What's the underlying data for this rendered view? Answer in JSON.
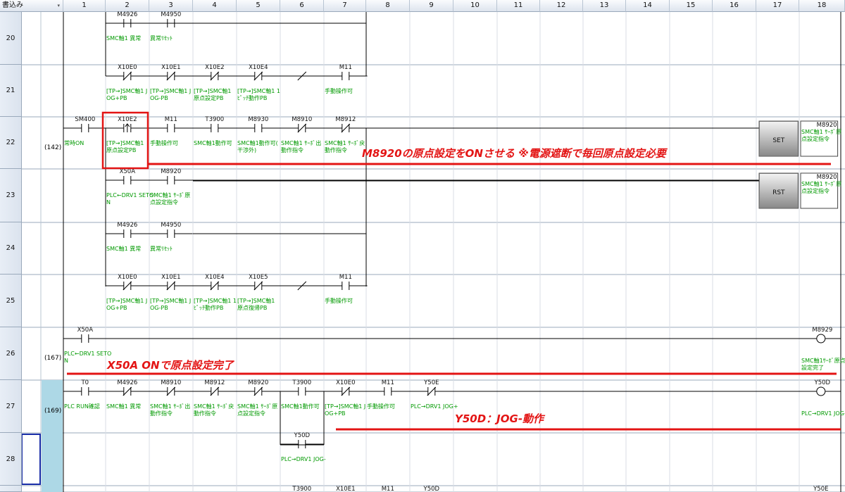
{
  "header": {
    "mode_label": "書込み",
    "dropdown_icon": "chevron-down-icon",
    "columns": [
      "1",
      "2",
      "3",
      "4",
      "5",
      "6",
      "7",
      "8",
      "9",
      "10",
      "11",
      "12",
      "13",
      "14",
      "15",
      "16",
      "17",
      "18"
    ]
  },
  "colors": {
    "wire": "#000000",
    "comment": "#009900",
    "annotation": "#e31414",
    "highlight_box": "#e31414",
    "cursor": "#1a2ea8",
    "selected_row_bg": "#add8e6"
  },
  "rows": [
    {
      "number": "20",
      "step": "",
      "elements": [
        {
          "col": 2,
          "type": "contact_no",
          "device": "M4926",
          "comment": "SMC軸1 異常"
        },
        {
          "col": 3,
          "type": "contact_no",
          "device": "M4950",
          "comment": "異常ﾘｾｯﾄ"
        }
      ]
    },
    {
      "number": "21",
      "step": "",
      "elements": [
        {
          "col": 2,
          "type": "contact_nc",
          "device": "X10E0",
          "comment": "[TP→]SMC軸1 JOG+PB"
        },
        {
          "col": 3,
          "type": "contact_nc",
          "device": "X10E1",
          "comment": "[TP→]SMC軸1 JOG-PB"
        },
        {
          "col": 4,
          "type": "contact_nc",
          "device": "X10E2",
          "comment": "[TP→]SMC軸1 原点設定PB"
        },
        {
          "col": 5,
          "type": "contact_nc",
          "device": "X10E4",
          "comment": "[TP→]SMC軸1 1ﾋﾟｯﾁ動作PB"
        },
        {
          "col": 6,
          "type": "slash",
          "device": "",
          "comment": ""
        },
        {
          "col": 7,
          "type": "contact_no",
          "device": "M11",
          "comment": "手動操作可"
        }
      ]
    },
    {
      "number": "22",
      "step": "(142)",
      "elements": [
        {
          "col": 1,
          "type": "contact_no",
          "device": "SM400",
          "comment": "常時ON"
        },
        {
          "col": 2,
          "type": "contact_rise",
          "device": "X10E2",
          "comment": "[TP→]SMC軸1 原点設定PB"
        },
        {
          "col": 3,
          "type": "contact_no",
          "device": "M11",
          "comment": "手動操作可"
        },
        {
          "col": 4,
          "type": "contact_no",
          "device": "T3900",
          "comment": "SMC軸1動作可"
        },
        {
          "col": 5,
          "type": "contact_no",
          "device": "M8930",
          "comment": "SMC軸1動作可(干渉外)"
        },
        {
          "col": 6,
          "type": "contact_nc",
          "device": "M8910",
          "comment": "SMC軸1 ｻｰﾎﾞ出動作指令"
        },
        {
          "col": 7,
          "type": "contact_nc",
          "device": "M8912",
          "comment": "SMC軸1 ｻｰﾎﾞ戻動作指令"
        },
        {
          "col": 17,
          "type": "func_set",
          "device": "SET",
          "comment": ""
        },
        {
          "col": 18,
          "type": "operand",
          "device": "M8920",
          "comment": "SMC軸1 ｻｰﾎﾞ原点設定指令"
        }
      ]
    },
    {
      "number": "23",
      "step": "",
      "elements": [
        {
          "col": 2,
          "type": "contact_no",
          "device": "X50A",
          "comment": "PLC←DRV1 SETON"
        },
        {
          "col": 3,
          "type": "contact_no",
          "device": "M8920",
          "comment": "SMC軸1 ｻｰﾎﾞ原点設定指令"
        },
        {
          "col": 17,
          "type": "func_rst",
          "device": "RST",
          "comment": ""
        },
        {
          "col": 18,
          "type": "operand",
          "device": "M8920",
          "comment": "SMC軸1 ｻｰﾎﾞ原点設定指令"
        }
      ]
    },
    {
      "number": "24",
      "step": "",
      "elements": [
        {
          "col": 2,
          "type": "contact_no",
          "device": "M4926",
          "comment": "SMC軸1 異常"
        },
        {
          "col": 3,
          "type": "contact_no",
          "device": "M4950",
          "comment": "異常ﾘｾｯﾄ"
        }
      ]
    },
    {
      "number": "25",
      "step": "",
      "elements": [
        {
          "col": 2,
          "type": "contact_nc",
          "device": "X10E0",
          "comment": "[TP→]SMC軸1 JOG+PB"
        },
        {
          "col": 3,
          "type": "contact_nc",
          "device": "X10E1",
          "comment": "[TP→]SMC軸1 JOG-PB"
        },
        {
          "col": 4,
          "type": "contact_nc",
          "device": "X10E4",
          "comment": "[TP→]SMC軸1 1ﾋﾟｯﾁ動作PB"
        },
        {
          "col": 5,
          "type": "contact_nc",
          "device": "X10E5",
          "comment": "[TP→]SMC軸1 原点復帰PB"
        },
        {
          "col": 6,
          "type": "slash",
          "device": "",
          "comment": ""
        },
        {
          "col": 7,
          "type": "contact_no",
          "device": "M11",
          "comment": "手動操作可"
        }
      ]
    },
    {
      "number": "26",
      "step": "(167)",
      "elements": [
        {
          "col": 1,
          "type": "contact_no",
          "device": "X50A",
          "comment": "PLC←DRV1 SETON"
        },
        {
          "col": 18,
          "type": "coil",
          "device": "M8929",
          "comment": "SMC軸1ｻｰﾎﾞ原点設定完了"
        }
      ]
    },
    {
      "number": "27",
      "step": "(169)",
      "elements": [
        {
          "col": 1,
          "type": "contact_no",
          "device": "T0",
          "comment": "PLC RUN確認"
        },
        {
          "col": 2,
          "type": "contact_nc",
          "device": "M4926",
          "comment": "SMC軸1 異常"
        },
        {
          "col": 3,
          "type": "contact_nc",
          "device": "M8910",
          "comment": "SMC軸1 ｻｰﾎﾞ出動作指令"
        },
        {
          "col": 4,
          "type": "contact_nc",
          "device": "M8912",
          "comment": "SMC軸1 ｻｰﾎﾞ戻動作指令"
        },
        {
          "col": 5,
          "type": "contact_nc",
          "device": "M8920",
          "comment": "SMC軸1 ｻｰﾎﾞ原点設定指令"
        },
        {
          "col": 6,
          "type": "contact_no",
          "device": "T3900",
          "comment": "SMC軸1動作可"
        },
        {
          "col": 7,
          "type": "contact_nc",
          "device": "X10E0",
          "comment": "[TP→]SMC軸1 JOG+PB"
        },
        {
          "col": 8,
          "type": "contact_no",
          "device": "M11",
          "comment": "手動操作可"
        },
        {
          "col": 9,
          "type": "contact_nc",
          "device": "Y50E",
          "comment": "PLC→DRV1 JOG+"
        },
        {
          "col": 18,
          "type": "coil",
          "device": "Y50D",
          "comment": "PLC→DRV1 JOG-"
        }
      ]
    },
    {
      "number": "28",
      "step": "",
      "elements": [
        {
          "col": 6,
          "type": "contact_no",
          "device": "Y50D",
          "comment": "PLC→DRV1 JOG-"
        }
      ]
    },
    {
      "number": "",
      "step": "",
      "elements": [
        {
          "col": 6,
          "type": "device_only",
          "device": "T3900",
          "comment": ""
        },
        {
          "col": 7,
          "type": "device_only",
          "device": "X10E1",
          "comment": ""
        },
        {
          "col": 8,
          "type": "device_only",
          "device": "M11",
          "comment": ""
        },
        {
          "col": 9,
          "type": "device_only",
          "device": "Y50D",
          "comment": ""
        },
        {
          "col": 18,
          "type": "device_only",
          "device": "Y50E",
          "comment": ""
        }
      ]
    }
  ],
  "annotations": [
    {
      "text": "M8920の原点設定をONさせる ※電源遮断で毎回原点設定必要"
    },
    {
      "text": "X50A ONで原点設定完了"
    },
    {
      "text": "Y50D：JOG-動作"
    }
  ]
}
